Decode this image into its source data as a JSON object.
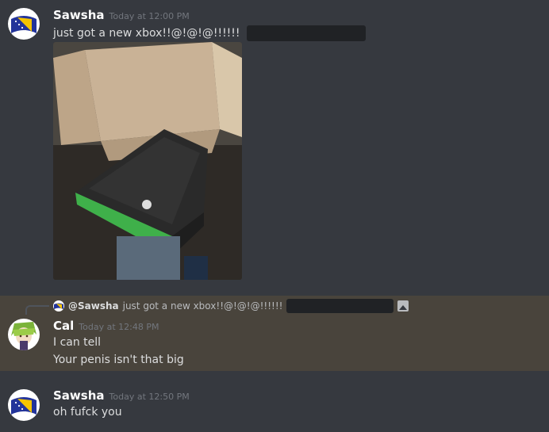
{
  "messages": [
    {
      "username": "Sawsha",
      "timestamp": "Today at 12:00 PM",
      "text": "just got a new xbox!!@!@!@!!!!!!"
    },
    {
      "reply": {
        "username": "@Sawsha",
        "text": "just got a new xbox!!@!@!@!!!!!!"
      },
      "username": "Cal",
      "timestamp": "Today at 12:48 PM",
      "lines": [
        "I can tell",
        "Your penis isn't that big"
      ]
    },
    {
      "username": "Sawsha",
      "timestamp": "Today at 12:50 PM",
      "text": "oh fufck you"
    }
  ],
  "colors": {
    "background": "#36393f",
    "highlight": "#49443c",
    "username": "#ffffff",
    "timestamp": "#72767d",
    "text": "#dcddde",
    "spoiler": "#202225"
  },
  "icons": {
    "avatar_sawsha": "bosnia-flag-avatar",
    "avatar_cal": "anime-character-avatar",
    "reply_attachment": "image-icon"
  }
}
